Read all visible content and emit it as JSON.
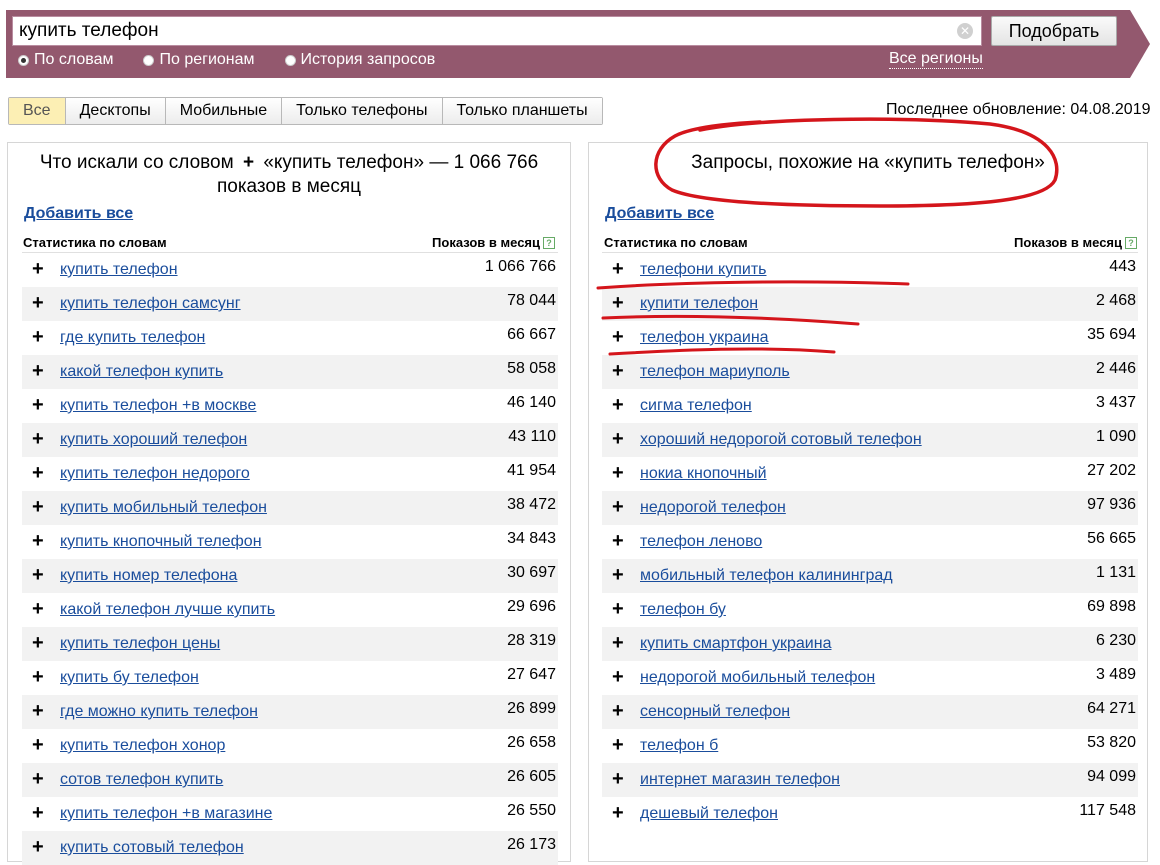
{
  "search": {
    "value": "купить телефон",
    "submit_label": "Подобрать"
  },
  "modes": [
    {
      "label": "По словам",
      "selected": true
    },
    {
      "label": "По регионам",
      "selected": false
    },
    {
      "label": "История запросов",
      "selected": false
    }
  ],
  "regions_link": "Все регионы",
  "device_tabs": [
    {
      "label": "Все",
      "active": true
    },
    {
      "label": "Десктопы",
      "active": false
    },
    {
      "label": "Мобильные",
      "active": false
    },
    {
      "label": "Только телефоны",
      "active": false
    },
    {
      "label": "Только планшеты",
      "active": false
    }
  ],
  "last_update": "Последнее обновление: 04.08.2019",
  "left_panel": {
    "title_prefix": "Что искали со словом",
    "title_plus": "+",
    "title_rest": "«купить телефон» — 1 066 766 показов в месяц",
    "add_all": "Добавить все",
    "col_words": "Статистика по словам",
    "col_count": "Показов в месяц",
    "rows": [
      {
        "phrase": "купить телефон",
        "count": "1 066 766"
      },
      {
        "phrase": "купить телефон самсунг",
        "count": "78 044"
      },
      {
        "phrase": "где купить телефон",
        "count": "66 667"
      },
      {
        "phrase": "какой телефон купить",
        "count": "58 058"
      },
      {
        "phrase": "купить телефон +в москве",
        "count": "46 140"
      },
      {
        "phrase": "купить хороший телефон",
        "count": "43 110"
      },
      {
        "phrase": "купить телефон недорого",
        "count": "41 954"
      },
      {
        "phrase": "купить мобильный телефон",
        "count": "38 472"
      },
      {
        "phrase": "купить кнопочный телефон",
        "count": "34 843"
      },
      {
        "phrase": "купить номер телефона",
        "count": "30 697"
      },
      {
        "phrase": "какой телефон лучше купить",
        "count": "29 696"
      },
      {
        "phrase": "купить телефон цены",
        "count": "28 319"
      },
      {
        "phrase": "купить бу телефон",
        "count": "27 647"
      },
      {
        "phrase": "где можно купить телефон",
        "count": "26 899"
      },
      {
        "phrase": "купить телефон хонор",
        "count": "26 658"
      },
      {
        "phrase": "сотов телефон купить",
        "count": "26 605"
      },
      {
        "phrase": "купить телефон +в магазине",
        "count": "26 550"
      },
      {
        "phrase": "купить сотовый телефон",
        "count": "26 173"
      }
    ]
  },
  "right_panel": {
    "title": "Запросы, похожие на «купить телефон»",
    "add_all": "Добавить все",
    "col_words": "Статистика по словам",
    "col_count": "Показов в месяц",
    "rows": [
      {
        "phrase": "телефони купить",
        "count": "443"
      },
      {
        "phrase": "купити телефон",
        "count": "2 468"
      },
      {
        "phrase": "телефон украина",
        "count": "35 694"
      },
      {
        "phrase": "телефон мариуполь",
        "count": "2 446"
      },
      {
        "phrase": "сигма телефон",
        "count": "3 437"
      },
      {
        "phrase": "хороший недорогой сотовый телефон",
        "count": "1 090"
      },
      {
        "phrase": "нокиа кнопочный",
        "count": "27 202"
      },
      {
        "phrase": "недорогой телефон",
        "count": "97 936"
      },
      {
        "phrase": "телефон леново",
        "count": "56 665"
      },
      {
        "phrase": "мобильный телефон калининград",
        "count": "1 131"
      },
      {
        "phrase": "телефон бу",
        "count": "69 898"
      },
      {
        "phrase": "купить смартфон украина",
        "count": "6 230"
      },
      {
        "phrase": "недорогой мобильный телефон",
        "count": "3 489"
      },
      {
        "phrase": "сенсорный телефон",
        "count": "64 271"
      },
      {
        "phrase": "телефон б",
        "count": "53 820"
      },
      {
        "phrase": "интернет магазин телефон",
        "count": "94 099"
      },
      {
        "phrase": "дешевый телефон",
        "count": "117 548"
      }
    ]
  },
  "colors": {
    "header_band": "#93586e",
    "link": "#1a4d9c",
    "annotation": "#d4151b",
    "active_tab": "#fcefb4"
  }
}
